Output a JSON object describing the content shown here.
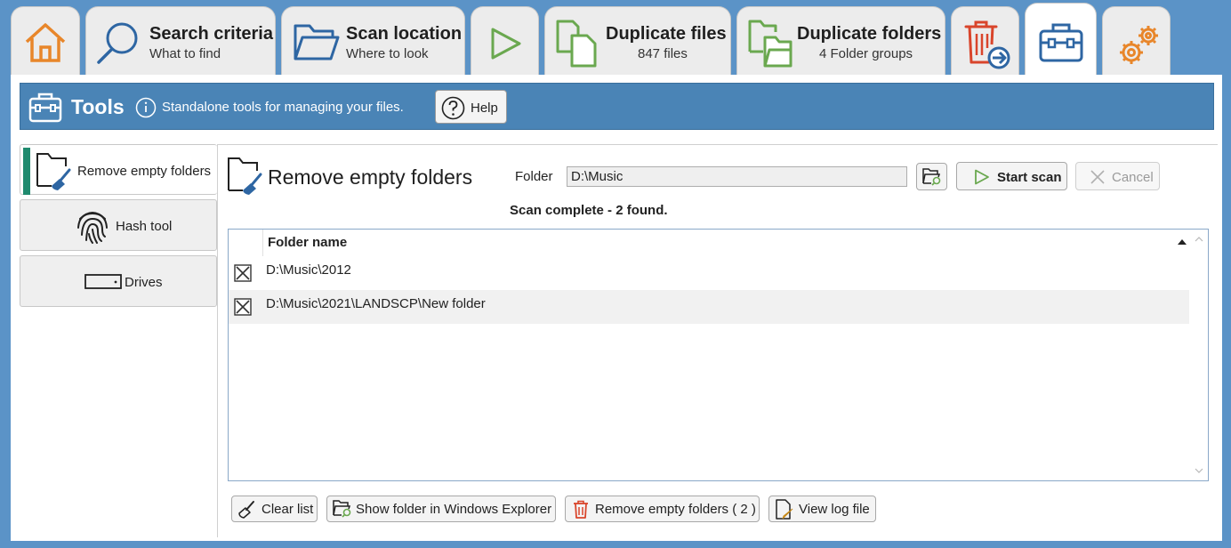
{
  "tabs": {
    "home": {
      "icon": "home-icon"
    },
    "search": {
      "title": "Search criteria",
      "subtitle": "What to find",
      "icon": "search-icon"
    },
    "scan": {
      "title": "Scan location",
      "subtitle": "Where to look",
      "icon": "folder-icon"
    },
    "run": {
      "icon": "play-icon"
    },
    "dupfiles": {
      "title": "Duplicate files",
      "subtitle": "847 files",
      "icon": "duplicate-files-icon"
    },
    "dupfolders": {
      "title": "Duplicate folders",
      "subtitle": "4 Folder groups",
      "icon": "duplicate-folders-icon"
    },
    "delete": {
      "icon": "trash-move-icon"
    },
    "tools": {
      "icon": "toolbox-icon"
    },
    "settings": {
      "icon": "gears-icon"
    }
  },
  "toolsbar": {
    "title": "Tools",
    "description": "Standalone tools for managing your files.",
    "help_label": "Help"
  },
  "sidebar": {
    "items": [
      {
        "label": "Remove empty folders",
        "icon": "folder-brush-icon"
      },
      {
        "label": "Hash tool",
        "icon": "fingerprint-icon"
      },
      {
        "label": "Drives",
        "icon": "drive-icon"
      }
    ]
  },
  "content": {
    "title": "Remove empty folders",
    "folder_label": "Folder",
    "folder_value": "D:\\Music",
    "start_scan_label": "Start scan",
    "cancel_label": "Cancel",
    "status": "Scan complete - 2 found."
  },
  "list": {
    "header": "Folder name",
    "rows": [
      "D:\\Music\\2012",
      "D:\\Music\\2021\\LANDSCP\\New folder"
    ]
  },
  "buttons": {
    "clear": "Clear list",
    "show": "Show folder in Windows Explorer",
    "remove": "Remove empty folders ( 2 )",
    "log": "View log file"
  },
  "colors": {
    "accent": "#4a84b6",
    "background": "#5b93c7",
    "home_orange": "#e8862a",
    "green": "#6aa84f",
    "red": "#d9452b"
  }
}
